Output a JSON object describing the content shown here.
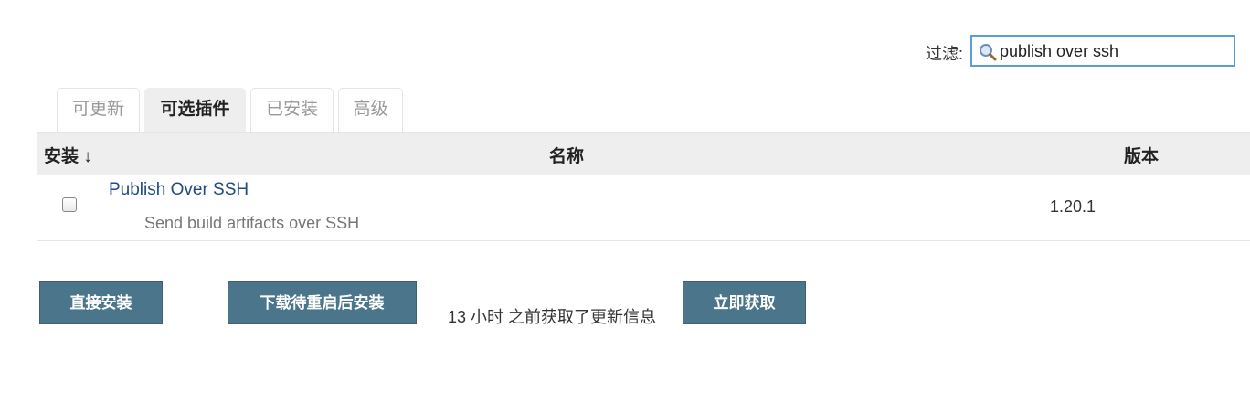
{
  "filter": {
    "label": "过滤:",
    "value": "publish over ssh",
    "icon": "search-icon"
  },
  "tabs": [
    {
      "label": "可更新",
      "active": false
    },
    {
      "label": "可选插件",
      "active": true
    },
    {
      "label": "已安装",
      "active": false
    },
    {
      "label": "高级",
      "active": false
    }
  ],
  "table": {
    "headers": {
      "install": "安装 ↓",
      "name": "名称",
      "version": "版本"
    },
    "rows": [
      {
        "checked": false,
        "name": "Publish Over SSH",
        "description": "Send build artifacts over SSH",
        "version": "1.20.1"
      }
    ]
  },
  "actions": {
    "install_now": "直接安装",
    "download_install_after_restart": "下载待重启后安装",
    "update_info": "13 小时 之前获取了更新信息",
    "check_now": "立即获取"
  },
  "colors": {
    "button_bg": "#4b758b",
    "link": "#204a87",
    "header_bg": "#eeeeee",
    "focus_border": "#5b9dd9"
  }
}
